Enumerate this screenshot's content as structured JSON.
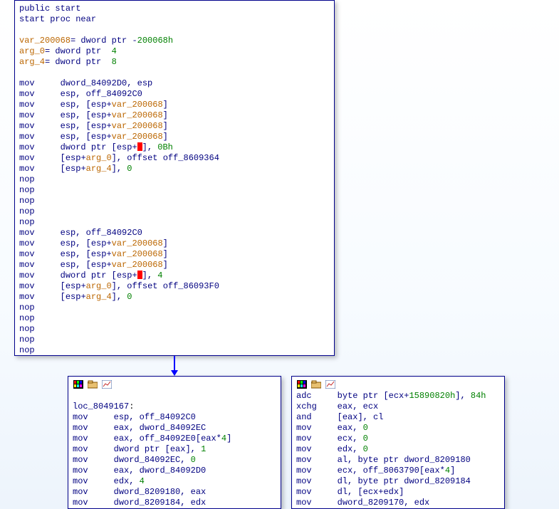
{
  "mnemonic_col": 8,
  "main_block": {
    "lines": [
      {
        "type": "raw",
        "segments": [
          {
            "t": "public",
            "c": "navy"
          },
          {
            "t": " start",
            "c": "navy"
          }
        ]
      },
      {
        "type": "raw",
        "segments": [
          {
            "t": "start ",
            "c": "navy"
          },
          {
            "t": "proc near",
            "c": "navy"
          }
        ]
      },
      {
        "type": "blank"
      },
      {
        "type": "raw",
        "segments": [
          {
            "t": "var_200068",
            "c": "orange"
          },
          {
            "t": "= ",
            "c": "navy"
          },
          {
            "t": "dword ptr ",
            "c": "navy"
          },
          {
            "t": "-",
            "c": "navy"
          },
          {
            "t": "200068h",
            "c": "green"
          }
        ]
      },
      {
        "type": "raw",
        "segments": [
          {
            "t": "arg_0",
            "c": "orange"
          },
          {
            "t": "= ",
            "c": "navy"
          },
          {
            "t": "dword ptr  ",
            "c": "navy"
          },
          {
            "t": "4",
            "c": "green"
          }
        ]
      },
      {
        "type": "raw",
        "segments": [
          {
            "t": "arg_4",
            "c": "orange"
          },
          {
            "t": "= ",
            "c": "navy"
          },
          {
            "t": "dword ptr  ",
            "c": "navy"
          },
          {
            "t": "8",
            "c": "green"
          }
        ]
      },
      {
        "type": "blank"
      },
      {
        "type": "instr",
        "mnemonic": "mov",
        "ops": [
          {
            "t": "dword_84092D0",
            "c": "navy"
          },
          {
            "t": ", ",
            "c": "navy"
          },
          {
            "t": "esp",
            "c": "navy"
          }
        ]
      },
      {
        "type": "instr",
        "mnemonic": "mov",
        "ops": [
          {
            "t": "esp",
            "c": "navy"
          },
          {
            "t": ", ",
            "c": "navy"
          },
          {
            "t": "off_84092C0",
            "c": "navy"
          }
        ]
      },
      {
        "type": "instr",
        "mnemonic": "mov",
        "ops": [
          {
            "t": "esp",
            "c": "navy"
          },
          {
            "t": ", [",
            "c": "navy"
          },
          {
            "t": "esp",
            "c": "navy"
          },
          {
            "t": "+",
            "c": "navy"
          },
          {
            "t": "var_200068",
            "c": "orange"
          },
          {
            "t": "]",
            "c": "navy"
          }
        ]
      },
      {
        "type": "instr",
        "mnemonic": "mov",
        "ops": [
          {
            "t": "esp",
            "c": "navy"
          },
          {
            "t": ", [",
            "c": "navy"
          },
          {
            "t": "esp",
            "c": "navy"
          },
          {
            "t": "+",
            "c": "navy"
          },
          {
            "t": "var_200068",
            "c": "orange"
          },
          {
            "t": "]",
            "c": "navy"
          }
        ]
      },
      {
        "type": "instr",
        "mnemonic": "mov",
        "ops": [
          {
            "t": "esp",
            "c": "navy"
          },
          {
            "t": ", [",
            "c": "navy"
          },
          {
            "t": "esp",
            "c": "navy"
          },
          {
            "t": "+",
            "c": "navy"
          },
          {
            "t": "var_200068",
            "c": "orange"
          },
          {
            "t": "]",
            "c": "navy"
          }
        ]
      },
      {
        "type": "instr",
        "mnemonic": "mov",
        "ops": [
          {
            "t": "esp",
            "c": "navy"
          },
          {
            "t": ", [",
            "c": "navy"
          },
          {
            "t": "esp",
            "c": "navy"
          },
          {
            "t": "+",
            "c": "navy"
          },
          {
            "t": "var_200068",
            "c": "orange"
          },
          {
            "t": "]",
            "c": "navy"
          }
        ]
      },
      {
        "type": "instr",
        "mnemonic": "mov",
        "ops": [
          {
            "t": "dword ptr ",
            "c": "navy"
          },
          {
            "t": "[",
            "c": "navy"
          },
          {
            "t": "esp",
            "c": "navy"
          },
          {
            "t": "+",
            "c": "navy"
          },
          {
            "t": "",
            "c": "bad"
          },
          {
            "t": "], ",
            "c": "navy"
          },
          {
            "t": "0Bh",
            "c": "green"
          }
        ]
      },
      {
        "type": "instr",
        "mnemonic": "mov",
        "ops": [
          {
            "t": "[",
            "c": "navy"
          },
          {
            "t": "esp",
            "c": "navy"
          },
          {
            "t": "+",
            "c": "navy"
          },
          {
            "t": "arg_0",
            "c": "orange"
          },
          {
            "t": "], ",
            "c": "navy"
          },
          {
            "t": "offset ",
            "c": "navy"
          },
          {
            "t": "off_8609364",
            "c": "navy"
          }
        ]
      },
      {
        "type": "instr",
        "mnemonic": "mov",
        "ops": [
          {
            "t": "[",
            "c": "navy"
          },
          {
            "t": "esp",
            "c": "navy"
          },
          {
            "t": "+",
            "c": "navy"
          },
          {
            "t": "arg_4",
            "c": "orange"
          },
          {
            "t": "], ",
            "c": "navy"
          },
          {
            "t": "0",
            "c": "green"
          }
        ]
      },
      {
        "type": "instr",
        "mnemonic": "nop",
        "ops": []
      },
      {
        "type": "instr",
        "mnemonic": "nop",
        "ops": []
      },
      {
        "type": "instr",
        "mnemonic": "nop",
        "ops": []
      },
      {
        "type": "instr",
        "mnemonic": "nop",
        "ops": []
      },
      {
        "type": "instr",
        "mnemonic": "nop",
        "ops": []
      },
      {
        "type": "instr",
        "mnemonic": "mov",
        "ops": [
          {
            "t": "esp",
            "c": "navy"
          },
          {
            "t": ", ",
            "c": "navy"
          },
          {
            "t": "off_84092C0",
            "c": "navy"
          }
        ]
      },
      {
        "type": "instr",
        "mnemonic": "mov",
        "ops": [
          {
            "t": "esp",
            "c": "navy"
          },
          {
            "t": ", [",
            "c": "navy"
          },
          {
            "t": "esp",
            "c": "navy"
          },
          {
            "t": "+",
            "c": "navy"
          },
          {
            "t": "var_200068",
            "c": "orange"
          },
          {
            "t": "]",
            "c": "navy"
          }
        ]
      },
      {
        "type": "instr",
        "mnemonic": "mov",
        "ops": [
          {
            "t": "esp",
            "c": "navy"
          },
          {
            "t": ", [",
            "c": "navy"
          },
          {
            "t": "esp",
            "c": "navy"
          },
          {
            "t": "+",
            "c": "navy"
          },
          {
            "t": "var_200068",
            "c": "orange"
          },
          {
            "t": "]",
            "c": "navy"
          }
        ]
      },
      {
        "type": "instr",
        "mnemonic": "mov",
        "ops": [
          {
            "t": "esp",
            "c": "navy"
          },
          {
            "t": ", [",
            "c": "navy"
          },
          {
            "t": "esp",
            "c": "navy"
          },
          {
            "t": "+",
            "c": "navy"
          },
          {
            "t": "var_200068",
            "c": "orange"
          },
          {
            "t": "]",
            "c": "navy"
          }
        ]
      },
      {
        "type": "instr",
        "mnemonic": "mov",
        "ops": [
          {
            "t": "dword ptr ",
            "c": "navy"
          },
          {
            "t": "[",
            "c": "navy"
          },
          {
            "t": "esp",
            "c": "navy"
          },
          {
            "t": "+",
            "c": "navy"
          },
          {
            "t": "",
            "c": "bad"
          },
          {
            "t": "], ",
            "c": "navy"
          },
          {
            "t": "4",
            "c": "green"
          }
        ]
      },
      {
        "type": "instr",
        "mnemonic": "mov",
        "ops": [
          {
            "t": "[",
            "c": "navy"
          },
          {
            "t": "esp",
            "c": "navy"
          },
          {
            "t": "+",
            "c": "navy"
          },
          {
            "t": "arg_0",
            "c": "orange"
          },
          {
            "t": "], ",
            "c": "navy"
          },
          {
            "t": "offset ",
            "c": "navy"
          },
          {
            "t": "off_86093F0",
            "c": "navy"
          }
        ]
      },
      {
        "type": "instr",
        "mnemonic": "mov",
        "ops": [
          {
            "t": "[",
            "c": "navy"
          },
          {
            "t": "esp",
            "c": "navy"
          },
          {
            "t": "+",
            "c": "navy"
          },
          {
            "t": "arg_4",
            "c": "orange"
          },
          {
            "t": "], ",
            "c": "navy"
          },
          {
            "t": "0",
            "c": "green"
          }
        ]
      },
      {
        "type": "instr",
        "mnemonic": "nop",
        "ops": []
      },
      {
        "type": "instr",
        "mnemonic": "nop",
        "ops": []
      },
      {
        "type": "instr",
        "mnemonic": "nop",
        "ops": []
      },
      {
        "type": "instr",
        "mnemonic": "nop",
        "ops": []
      },
      {
        "type": "instr",
        "mnemonic": "nop",
        "ops": []
      }
    ]
  },
  "loc_block": {
    "lines": [
      {
        "type": "blank"
      },
      {
        "type": "raw",
        "segments": [
          {
            "t": "loc_8049167",
            "c": "navy"
          },
          {
            "t": ":",
            "c": "black"
          }
        ]
      },
      {
        "type": "instr",
        "mnemonic": "mov",
        "ops": [
          {
            "t": "esp",
            "c": "navy"
          },
          {
            "t": ", ",
            "c": "navy"
          },
          {
            "t": "off_84092C0",
            "c": "navy"
          }
        ]
      },
      {
        "type": "instr",
        "mnemonic": "mov",
        "ops": [
          {
            "t": "eax",
            "c": "navy"
          },
          {
            "t": ", ",
            "c": "navy"
          },
          {
            "t": "dword_84092EC",
            "c": "navy"
          }
        ]
      },
      {
        "type": "instr",
        "mnemonic": "mov",
        "ops": [
          {
            "t": "eax",
            "c": "navy"
          },
          {
            "t": ", ",
            "c": "navy"
          },
          {
            "t": "off_84092E0",
            "c": "navy"
          },
          {
            "t": "[",
            "c": "navy"
          },
          {
            "t": "eax",
            "c": "navy"
          },
          {
            "t": "*",
            "c": "navy"
          },
          {
            "t": "4",
            "c": "green"
          },
          {
            "t": "]",
            "c": "navy"
          }
        ]
      },
      {
        "type": "instr",
        "mnemonic": "mov",
        "ops": [
          {
            "t": "dword ptr ",
            "c": "navy"
          },
          {
            "t": "[",
            "c": "navy"
          },
          {
            "t": "eax",
            "c": "navy"
          },
          {
            "t": "], ",
            "c": "navy"
          },
          {
            "t": "1",
            "c": "green"
          }
        ]
      },
      {
        "type": "instr",
        "mnemonic": "mov",
        "ops": [
          {
            "t": "dword_84092EC",
            "c": "navy"
          },
          {
            "t": ", ",
            "c": "navy"
          },
          {
            "t": "0",
            "c": "green"
          }
        ]
      },
      {
        "type": "instr",
        "mnemonic": "mov",
        "ops": [
          {
            "t": "eax",
            "c": "navy"
          },
          {
            "t": ", ",
            "c": "navy"
          },
          {
            "t": "dword_84092D0",
            "c": "navy"
          }
        ]
      },
      {
        "type": "instr",
        "mnemonic": "mov",
        "ops": [
          {
            "t": "edx",
            "c": "navy"
          },
          {
            "t": ", ",
            "c": "navy"
          },
          {
            "t": "4",
            "c": "green"
          }
        ]
      },
      {
        "type": "instr",
        "mnemonic": "mov",
        "ops": [
          {
            "t": "dword_8209180",
            "c": "navy"
          },
          {
            "t": ", ",
            "c": "navy"
          },
          {
            "t": "eax",
            "c": "navy"
          }
        ]
      },
      {
        "type": "instr",
        "mnemonic": "mov",
        "ops": [
          {
            "t": "dword_8209184",
            "c": "navy"
          },
          {
            "t": ", ",
            "c": "navy"
          },
          {
            "t": "edx",
            "c": "navy"
          }
        ]
      }
    ]
  },
  "right_block": {
    "lines": [
      {
        "type": "instr",
        "mnemonic": "adc",
        "ops": [
          {
            "t": "byte ptr ",
            "c": "navy"
          },
          {
            "t": "[",
            "c": "navy"
          },
          {
            "t": "ecx",
            "c": "navy"
          },
          {
            "t": "+",
            "c": "navy"
          },
          {
            "t": "15890820h",
            "c": "green"
          },
          {
            "t": "], ",
            "c": "navy"
          },
          {
            "t": "84h",
            "c": "green"
          }
        ]
      },
      {
        "type": "instr",
        "mnemonic": "xchg",
        "ops": [
          {
            "t": "eax",
            "c": "navy"
          },
          {
            "t": ", ",
            "c": "navy"
          },
          {
            "t": "ecx",
            "c": "navy"
          }
        ]
      },
      {
        "type": "instr",
        "mnemonic": "and",
        "ops": [
          {
            "t": "[",
            "c": "navy"
          },
          {
            "t": "eax",
            "c": "navy"
          },
          {
            "t": "], ",
            "c": "navy"
          },
          {
            "t": "cl",
            "c": "navy"
          }
        ]
      },
      {
        "type": "instr",
        "mnemonic": "mov",
        "ops": [
          {
            "t": "eax",
            "c": "navy"
          },
          {
            "t": ", ",
            "c": "navy"
          },
          {
            "t": "0",
            "c": "green"
          }
        ]
      },
      {
        "type": "instr",
        "mnemonic": "mov",
        "ops": [
          {
            "t": "ecx",
            "c": "navy"
          },
          {
            "t": ", ",
            "c": "navy"
          },
          {
            "t": "0",
            "c": "green"
          }
        ]
      },
      {
        "type": "instr",
        "mnemonic": "mov",
        "ops": [
          {
            "t": "edx",
            "c": "navy"
          },
          {
            "t": ", ",
            "c": "navy"
          },
          {
            "t": "0",
            "c": "green"
          }
        ]
      },
      {
        "type": "instr",
        "mnemonic": "mov",
        "ops": [
          {
            "t": "al",
            "c": "navy"
          },
          {
            "t": ", ",
            "c": "navy"
          },
          {
            "t": "byte ptr ",
            "c": "navy"
          },
          {
            "t": "dword_8209180",
            "c": "navy"
          }
        ]
      },
      {
        "type": "instr",
        "mnemonic": "mov",
        "ops": [
          {
            "t": "ecx",
            "c": "navy"
          },
          {
            "t": ", ",
            "c": "navy"
          },
          {
            "t": "off_8063790",
            "c": "navy"
          },
          {
            "t": "[",
            "c": "navy"
          },
          {
            "t": "eax",
            "c": "navy"
          },
          {
            "t": "*",
            "c": "navy"
          },
          {
            "t": "4",
            "c": "green"
          },
          {
            "t": "]",
            "c": "navy"
          }
        ]
      },
      {
        "type": "instr",
        "mnemonic": "mov",
        "ops": [
          {
            "t": "dl",
            "c": "navy"
          },
          {
            "t": ", ",
            "c": "navy"
          },
          {
            "t": "byte ptr ",
            "c": "navy"
          },
          {
            "t": "dword_8209184",
            "c": "navy"
          }
        ]
      },
      {
        "type": "instr",
        "mnemonic": "mov",
        "ops": [
          {
            "t": "dl",
            "c": "navy"
          },
          {
            "t": ", [",
            "c": "navy"
          },
          {
            "t": "ecx",
            "c": "navy"
          },
          {
            "t": "+",
            "c": "navy"
          },
          {
            "t": "edx",
            "c": "navy"
          },
          {
            "t": "]",
            "c": "navy"
          }
        ]
      },
      {
        "type": "instr",
        "mnemonic": "mov",
        "ops": [
          {
            "t": "dword_8209170",
            "c": "navy"
          },
          {
            "t": ", ",
            "c": "navy"
          },
          {
            "t": "edx",
            "c": "navy"
          }
        ]
      }
    ]
  }
}
